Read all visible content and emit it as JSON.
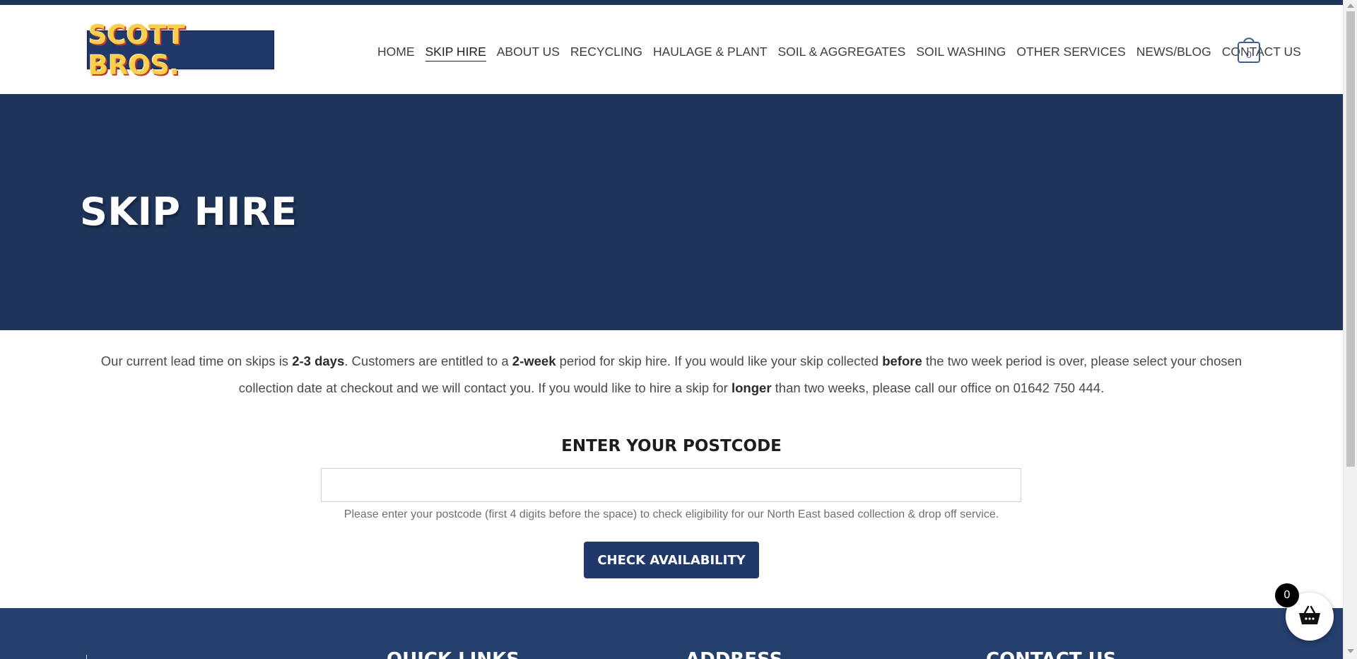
{
  "header": {
    "logo_text": "SCOTT BROS.",
    "nav": [
      {
        "label": "HOME"
      },
      {
        "label": "SKIP HIRE"
      },
      {
        "label": "ABOUT US"
      },
      {
        "label": "RECYCLING"
      },
      {
        "label": "HAULAGE & PLANT"
      },
      {
        "label": "SOIL & AGGREGATES"
      },
      {
        "label": "SOIL WASHING"
      },
      {
        "label": "OTHER SERVICES"
      },
      {
        "label": "NEWS/BLOG"
      },
      {
        "label": "CONTACT US"
      }
    ],
    "active_nav": "SKIP HIRE",
    "cart_count": "0",
    "cart_icon": "shopping-bag-icon"
  },
  "hero": {
    "title": "SKIP HIRE"
  },
  "intro": {
    "p1": "Our current lead time on skips is ",
    "b1": "2-3 days",
    "p2": ". Customers are entitled to a ",
    "b2": "2-week",
    "p3": " period for skip hire. If you would like your skip collected ",
    "b3": "before",
    "p4": " the two week period is over, please select your chosen collection date at checkout and we will contact you. If you would like to hire a skip for ",
    "b4": "longer",
    "p5": " than two weeks, please call our office on 01642 750 444."
  },
  "postcode": {
    "title": "ENTER YOUR POSTCODE",
    "value": "",
    "help": "Please enter your postcode (first 4 digits before the space) to check eligibility for our North East based collection & drop off service.",
    "button_label": "CHECK AVAILABILITY"
  },
  "footer": {
    "headings": [
      "QUICK LINKS",
      "ADDRESS",
      "CONTACT US"
    ]
  },
  "floating_basket": {
    "count": "0",
    "icon": "basket-icon"
  },
  "colors": {
    "navy": "#1e3459",
    "footer_navy": "#26406e",
    "button_navy": "#21386b",
    "logo_yellow": "#f7cf4a"
  }
}
